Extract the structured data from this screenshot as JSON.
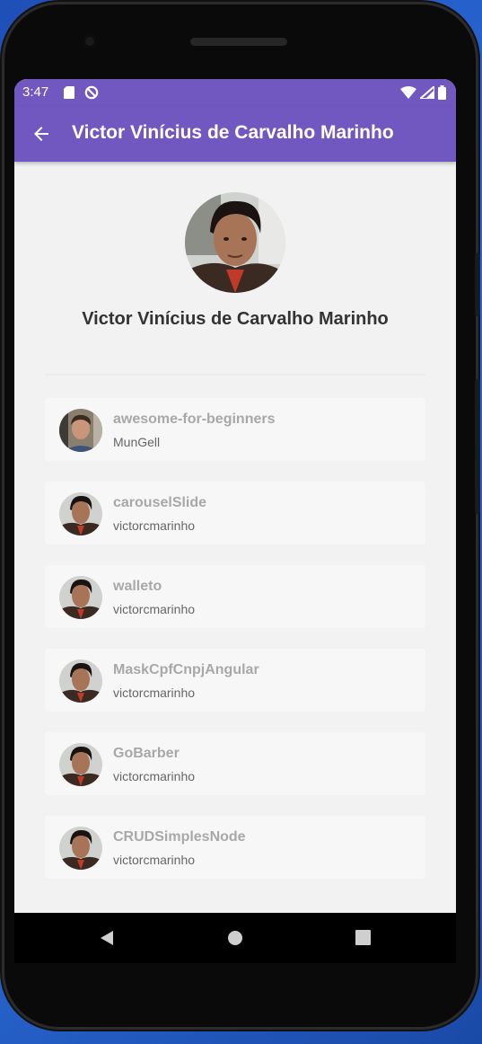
{
  "status_bar": {
    "time": "3:47",
    "icons": [
      "sd-card-icon",
      "sync-disabled-icon",
      "wifi-icon",
      "signal-icon",
      "battery-icon"
    ]
  },
  "app_bar": {
    "title": "Victor Vinícius de Carvalho Marinho",
    "back_icon": "arrow-left-icon",
    "color": "#7158c1"
  },
  "profile": {
    "name": "Victor Vinícius de Carvalho Marinho"
  },
  "repositories": [
    {
      "name": "awesome-for-beginners",
      "owner": "MunGell",
      "avatar": "munGell-avatar"
    },
    {
      "name": "carouselSlide",
      "owner": "victorcmarinho",
      "avatar": "victor-avatar"
    },
    {
      "name": "walleto",
      "owner": "victorcmarinho",
      "avatar": "victor-avatar"
    },
    {
      "name": "MaskCpfCnpjAngular",
      "owner": "victorcmarinho",
      "avatar": "victor-avatar"
    },
    {
      "name": "GoBarber",
      "owner": "victorcmarinho",
      "avatar": "victor-avatar"
    },
    {
      "name": "CRUDSimplesNode",
      "owner": "victorcmarinho",
      "avatar": "victor-avatar"
    }
  ],
  "nav_bar": {
    "icons": [
      "nav-back-icon",
      "nav-home-icon",
      "nav-recents-icon"
    ]
  }
}
